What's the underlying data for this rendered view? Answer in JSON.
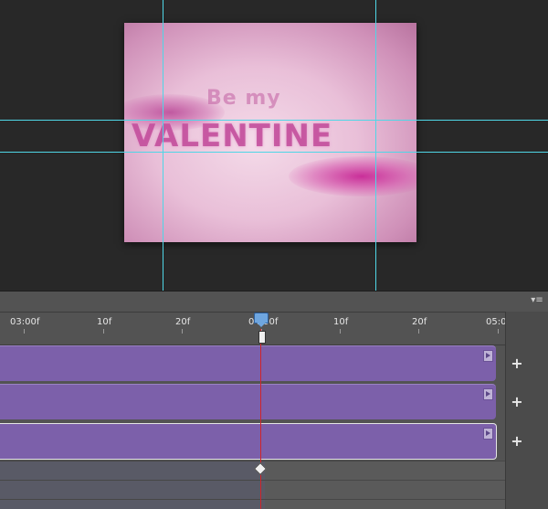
{
  "artwork": {
    "line1": "Be my",
    "line2": "VALENTINE"
  },
  "timeline": {
    "ruler_labels": [
      "03:00f",
      "10f",
      "20f",
      "04:00f",
      "10f",
      "20f",
      "05:0"
    ],
    "panel_menu_icon": "panel-menu-icon",
    "add_label": "+",
    "tracks": [
      {
        "selected": false,
        "arrow_icon": "play-triangle-icon"
      },
      {
        "selected": false,
        "arrow_icon": "play-triangle-icon"
      },
      {
        "selected": true,
        "arrow_icon": "play-triangle-icon"
      }
    ],
    "colors": {
      "track": "#7c60aa",
      "playhead": "#d0242a",
      "guides": "#4fd6e6",
      "panel": "#535353"
    }
  }
}
